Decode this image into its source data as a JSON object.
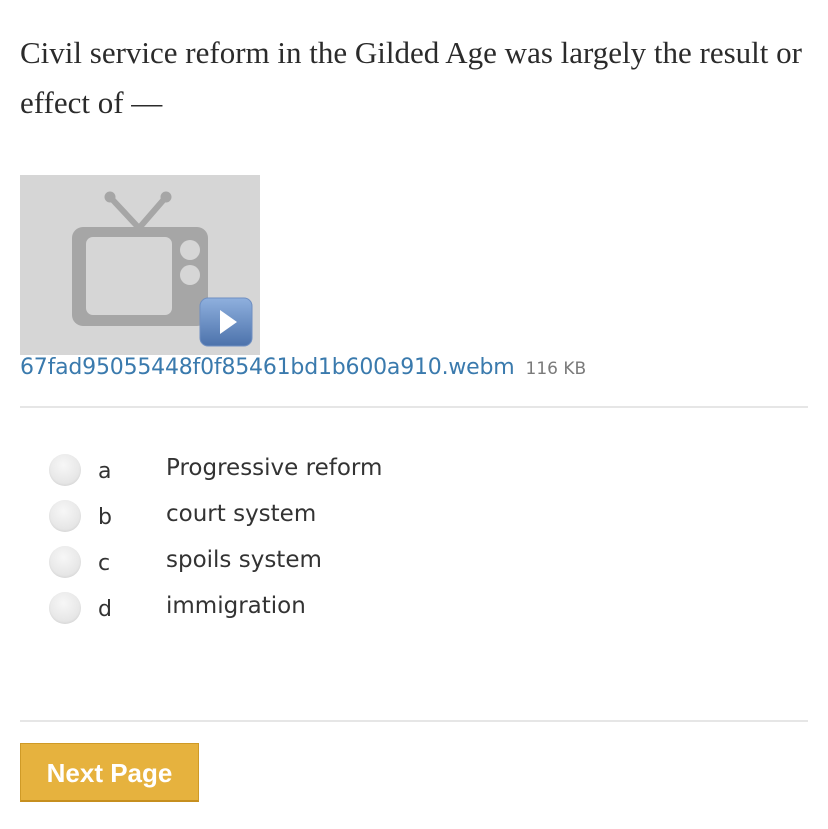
{
  "question": {
    "text": "Civil service reform in the Gilded Age was largely the result or effect of —"
  },
  "media": {
    "icon": "tv-icon",
    "play_icon": "play-icon",
    "filename": "67fad95055448f0f85461bd1b600a910.webm",
    "size": "116 KB"
  },
  "choices": [
    {
      "letter": "a",
      "text": "Progressive reform"
    },
    {
      "letter": "b",
      "text": "court system"
    },
    {
      "letter": "c",
      "text": "spoils system"
    },
    {
      "letter": "d",
      "text": "immigration"
    }
  ],
  "navigation": {
    "next_label": "Next Page"
  },
  "colors": {
    "link": "#3a7aad",
    "button": "#e6b23e",
    "thumbnail_bg": "#d6d6d6",
    "play_button": "#5a7fb5"
  }
}
